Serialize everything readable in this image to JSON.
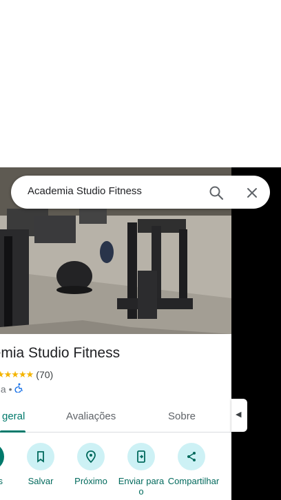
{
  "search": {
    "query": "Academia Studio Fitness"
  },
  "place": {
    "title": "demia Studio Fitness",
    "rating": "(70)",
    "category": "nia •"
  },
  "tabs": [
    {
      "label": "geral",
      "active": true
    },
    {
      "label": "Avaliações",
      "active": false
    },
    {
      "label": "Sobre",
      "active": false
    }
  ],
  "actions": [
    {
      "label": "s",
      "icon": "directions-icon"
    },
    {
      "label": "Salvar",
      "icon": "bookmark-icon"
    },
    {
      "label": "Próximo",
      "icon": "nearby-icon"
    },
    {
      "label": "Enviar para o",
      "icon": "send-to-phone-icon"
    },
    {
      "label": "Compartilhar",
      "icon": "share-icon"
    }
  ],
  "colors": {
    "accent": "#00796b",
    "action_bg": "#cdf1f5",
    "star": "#f4b400"
  }
}
